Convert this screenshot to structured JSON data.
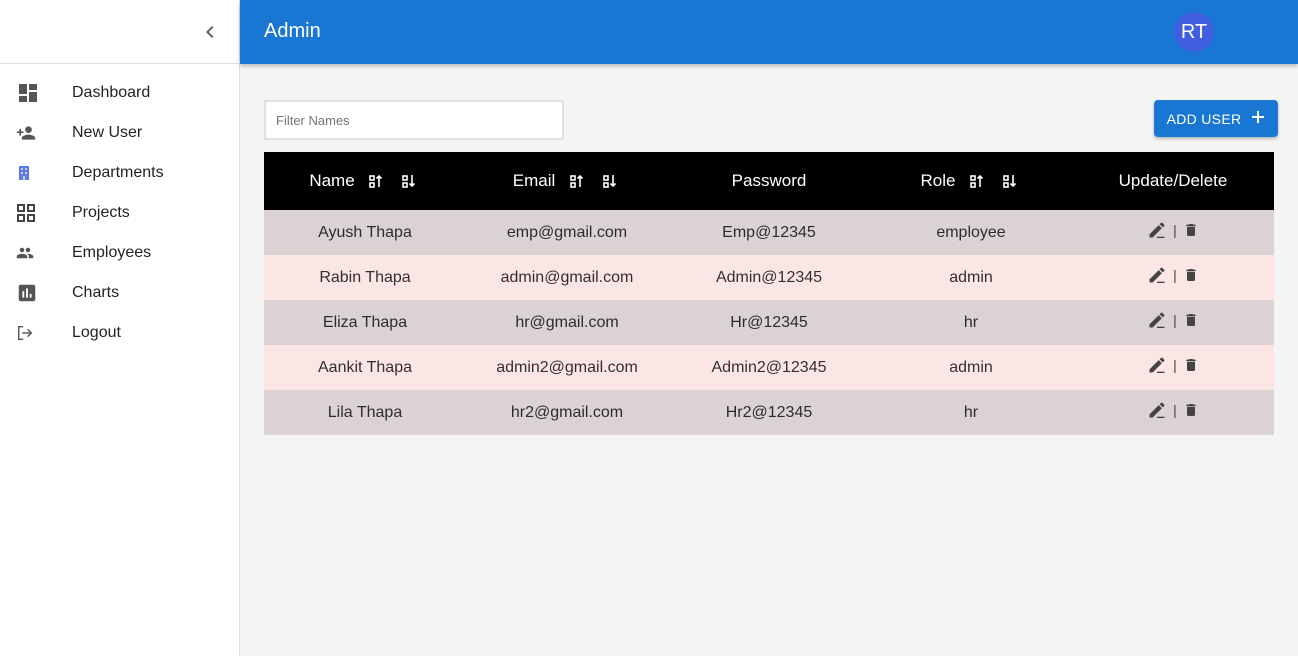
{
  "header": {
    "title": "Admin",
    "avatar_initials": "RT"
  },
  "sidebar": {
    "items": [
      {
        "label": "Dashboard",
        "icon": "dashboard-icon"
      },
      {
        "label": "New User",
        "icon": "person-add-icon"
      },
      {
        "label": "Departments",
        "icon": "building-icon"
      },
      {
        "label": "Projects",
        "icon": "grid-view-icon"
      },
      {
        "label": "Employees",
        "icon": "people-icon"
      },
      {
        "label": "Charts",
        "icon": "bar-chart-icon"
      },
      {
        "label": "Logout",
        "icon": "logout-icon"
      }
    ]
  },
  "toolbar": {
    "filter_placeholder": "Filter Names",
    "add_label": "ADD USER"
  },
  "table": {
    "columns": [
      "Name",
      "Email",
      "Password",
      "Role",
      "Update/Delete"
    ],
    "separator": "|",
    "rows": [
      {
        "name": "Ayush Thapa",
        "email": "emp@gmail.com",
        "password": "Emp@12345",
        "role": "employee"
      },
      {
        "name": "Rabin Thapa",
        "email": "admin@gmail.com",
        "password": "Admin@12345",
        "role": "admin"
      },
      {
        "name": "Eliza Thapa",
        "email": "hr@gmail.com",
        "password": "Hr@12345",
        "role": "hr"
      },
      {
        "name": "Aankit Thapa",
        "email": "admin2@gmail.com",
        "password": "Admin2@12345",
        "role": "admin"
      },
      {
        "name": "Lila Thapa",
        "email": "hr2@gmail.com",
        "password": "Hr2@12345",
        "role": "hr"
      }
    ]
  },
  "colors": {
    "primary": "#1976d2",
    "avatar": "#3f5fe0",
    "row_odd": "#dbd3d3",
    "row_even": "#fbe5e5",
    "header_bg": "#000000"
  }
}
